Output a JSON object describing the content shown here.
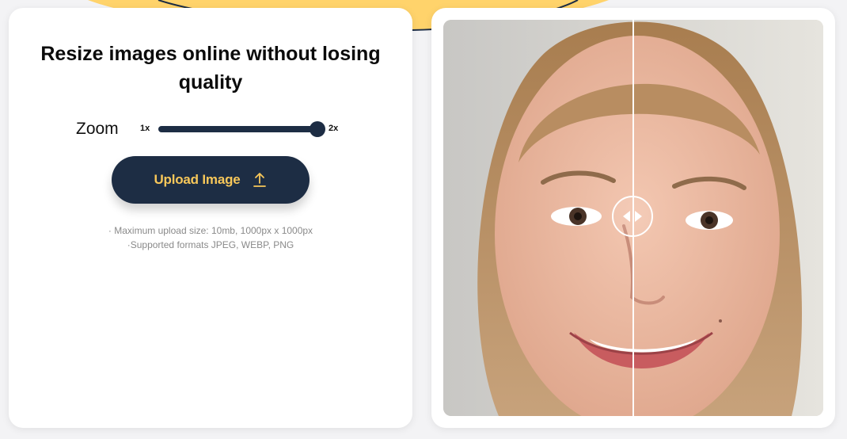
{
  "left_panel": {
    "title": "Resize images online without losing quality",
    "zoom": {
      "label": "Zoom",
      "min_label": "1x",
      "max_label": "2x",
      "value": 2
    },
    "upload_button": {
      "label": "Upload Image",
      "icon": "upload-arrow-icon"
    },
    "notes": [
      "· Maximum upload size: 10mb, 1000px x 1000px",
      "·Supported formats JPEG, WEBP, PNG"
    ]
  },
  "right_panel": {
    "image": "before-after-portrait",
    "handle_icon": "left-right-arrows-icon",
    "split_position": 0.5
  },
  "colors": {
    "accent": "#f7c75a",
    "navy": "#1d2d44",
    "background": "#f3f3f5",
    "blob": "#ffd36b",
    "text": "#0b0b0b",
    "muted": "#8a8a8a"
  }
}
